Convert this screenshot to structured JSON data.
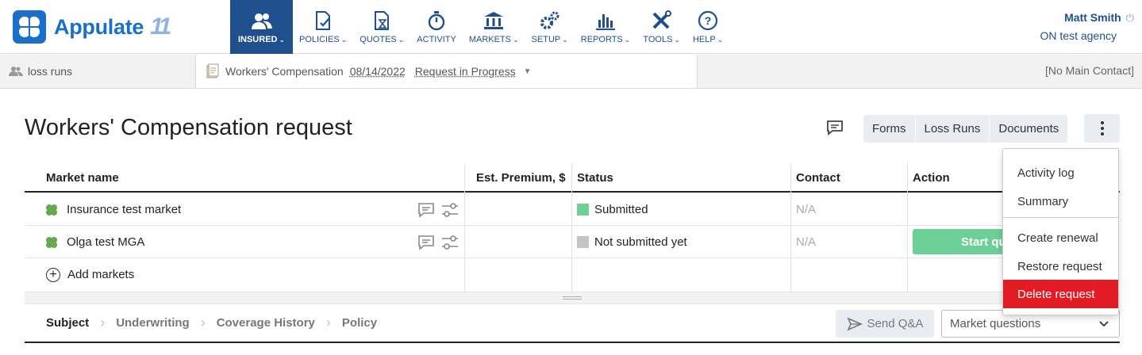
{
  "brand": {
    "name": "Appulate",
    "version_mark": "11",
    "color": "#1a6fc9"
  },
  "nav": [
    {
      "label": "INSURED",
      "icon": "insured-icon",
      "active": true
    },
    {
      "label": "POLICIES",
      "icon": "policies-icon"
    },
    {
      "label": "QUOTES",
      "icon": "quotes-icon"
    },
    {
      "label": "ACTIVITY",
      "icon": "activity-icon"
    },
    {
      "label": "MARKETS",
      "icon": "markets-icon"
    },
    {
      "label": "SETUP",
      "icon": "setup-icon"
    },
    {
      "label": "REPORTS",
      "icon": "reports-icon"
    },
    {
      "label": "TOOLS",
      "icon": "tools-icon"
    },
    {
      "label": "HELP",
      "icon": "help-icon"
    }
  ],
  "user": {
    "name": "Matt Smith",
    "agency": "ON test agency"
  },
  "context": {
    "insured": "loss runs",
    "line": "Workers' Compensation",
    "date": "08/14/2022",
    "status": "Request in Progress",
    "contact": "[No Main Contact]"
  },
  "page": {
    "title": "Workers' Compensation request"
  },
  "header_tabs": {
    "forms": "Forms",
    "loss_runs": "Loss Runs",
    "documents": "Documents"
  },
  "table": {
    "columns": {
      "market": "Market name",
      "premium": "Est. Premium, $",
      "status": "Status",
      "contact": "Contact",
      "action": "Action"
    },
    "rows": [
      {
        "market": "Insurance test market",
        "premium": "",
        "status": "Submitted",
        "status_color": "#6fcf97",
        "contact": "N/A",
        "action": ""
      },
      {
        "market": "Olga test MGA",
        "premium": "",
        "status": "Not submitted yet",
        "status_color": "#c4c4c4",
        "contact": "N/A",
        "action": "Start qu"
      }
    ],
    "add_markets": "Add markets"
  },
  "bottom_tabs": [
    {
      "label": "Subject",
      "active": true
    },
    {
      "label": "Underwriting"
    },
    {
      "label": "Coverage History"
    },
    {
      "label": "Policy"
    }
  ],
  "send_qa": "Send Q&A",
  "market_questions": "Market questions",
  "menu": {
    "items": [
      "Activity log",
      "Summary",
      "Create renewal",
      "Restore request",
      "Delete request"
    ]
  }
}
